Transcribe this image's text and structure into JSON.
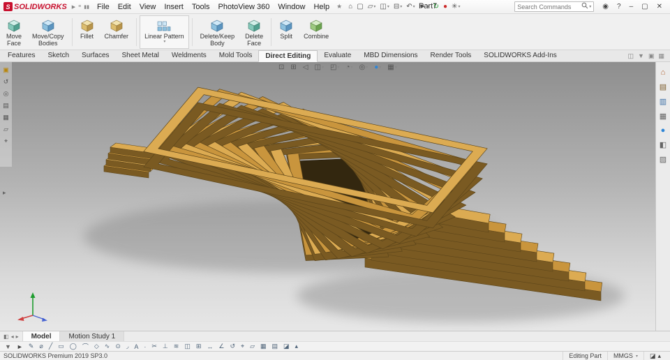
{
  "titlebar": {
    "brand": "SOLIDWORKS",
    "app_icon_letter": "S",
    "left_icons": [
      {
        "name": "play-icon",
        "glyph": "▶"
      },
      {
        "name": "list-icon",
        "glyph": "≡"
      },
      {
        "name": "pause-icon",
        "glyph": "▮▮"
      }
    ],
    "menus": [
      "File",
      "Edit",
      "View",
      "Insert",
      "Tools",
      "PhotoView 360",
      "Window",
      "Help"
    ],
    "pin_icon": "★",
    "quick_tools": [
      {
        "name": "home-icon",
        "glyph": "⌂"
      },
      {
        "name": "new-document-icon",
        "glyph": "▢"
      },
      {
        "name": "open-icon",
        "glyph": "▱",
        "dd": true
      },
      {
        "name": "save-icon",
        "glyph": "◫",
        "dd": true
      },
      {
        "name": "print-icon",
        "glyph": "⊟",
        "dd": true
      },
      {
        "name": "undo-icon",
        "glyph": "↶",
        "dd": true
      },
      {
        "name": "select-icon",
        "glyph": "►",
        "dd": true
      },
      {
        "name": "rebuild-icon",
        "glyph": "↻",
        "color": "#1f9d2f"
      },
      {
        "name": "stoplight-icon",
        "glyph": "●",
        "color": "#cc2a2a"
      },
      {
        "name": "options-icon",
        "glyph": "✳",
        "dd": true
      }
    ],
    "document_title": "Part7",
    "search": {
      "placeholder": "Search Commands",
      "dropdown_icon": "▾"
    },
    "window_controls": [
      {
        "name": "user-icon",
        "glyph": "◉"
      },
      {
        "name": "help-icon",
        "glyph": "?"
      },
      {
        "name": "minimize-icon",
        "glyph": "–"
      },
      {
        "name": "restore-icon",
        "glyph": "▢"
      },
      {
        "name": "close-icon",
        "glyph": "✕"
      }
    ]
  },
  "ribbon": {
    "buttons": [
      {
        "line1": "Move",
        "line2": "Face"
      },
      {
        "line1": "Move/Copy",
        "line2": "Bodies"
      },
      {
        "line1": "Fillet"
      },
      {
        "line1": "Chamfer"
      },
      {
        "line1": "Linear Pattern"
      },
      {
        "line1": "Delete/Keep",
        "line2": "Body"
      },
      {
        "line1": "Delete",
        "line2": "Face"
      },
      {
        "line1": "Split"
      },
      {
        "line1": "Combine"
      }
    ]
  },
  "tabs": {
    "items": [
      {
        "label": "Features"
      },
      {
        "label": "Sketch"
      },
      {
        "label": "Surfaces"
      },
      {
        "label": "Sheet Metal"
      },
      {
        "label": "Weldments"
      },
      {
        "label": "Mold Tools"
      },
      {
        "label": "Direct Editing",
        "active": true
      },
      {
        "label": "Evaluate"
      },
      {
        "label": "MBD Dimensions"
      },
      {
        "label": "Render Tools"
      },
      {
        "label": "SOLIDWORKS Add-Ins"
      }
    ],
    "right_icons": [
      {
        "name": "featuremanager-toggle-icon",
        "glyph": "◫"
      },
      {
        "name": "ribbon-pin-icon",
        "glyph": "▼"
      },
      {
        "name": "display-pane-icon",
        "glyph": "▣"
      },
      {
        "name": "ribbon-help-icon",
        "glyph": "▦"
      }
    ]
  },
  "viewport": {
    "hud_icons": [
      {
        "name": "zoom-fit-icon",
        "glyph": "⊡"
      },
      {
        "name": "zoom-area-icon",
        "glyph": "⊞"
      },
      {
        "name": "previous-view-icon",
        "glyph": "◁"
      },
      {
        "name": "section-view-icon",
        "glyph": "◫",
        "dd": true
      },
      {
        "name": "view-orientation-icon",
        "glyph": "◰",
        "dd": true
      },
      {
        "name": "display-style-icon",
        "glyph": "◔",
        "dd": true
      },
      {
        "name": "hide-show-items-icon",
        "glyph": "◎",
        "dd": true
      },
      {
        "name": "appearances-icon",
        "glyph": "●",
        "color": "#2f86d6",
        "dd": true
      },
      {
        "name": "scene-icon",
        "glyph": "▦",
        "dd": true
      }
    ],
    "left_tree_icons": [
      {
        "name": "part-icon",
        "glyph": "▣",
        "color": "#b8860b"
      },
      {
        "name": "history-icon",
        "glyph": "↺"
      },
      {
        "name": "sensors-icon",
        "glyph": "◎"
      },
      {
        "name": "annotations-icon",
        "glyph": "▤"
      },
      {
        "name": "material-icon",
        "glyph": "▦"
      },
      {
        "name": "plane-icon",
        "glyph": "▱"
      },
      {
        "name": "origin-icon",
        "glyph": "⌖"
      }
    ],
    "flyout_arrow_icon": "▸",
    "task_pane_icons": [
      {
        "name": "resources-home-icon",
        "glyph": "⌂",
        "color": "#b06030"
      },
      {
        "name": "design-library-icon",
        "glyph": "▤",
        "color": "#7a5a2a"
      },
      {
        "name": "file-explorer-icon",
        "glyph": "▥",
        "color": "#3a6ea5"
      },
      {
        "name": "view-palette-icon",
        "glyph": "▦",
        "color": "#666666"
      },
      {
        "name": "appearances-pane-icon",
        "glyph": "●",
        "color": "#2f86d6"
      },
      {
        "name": "scenes-icon",
        "glyph": "◧",
        "color": "#666666"
      },
      {
        "name": "custom-properties-icon",
        "glyph": "▨",
        "color": "#666666"
      }
    ],
    "bg_top": "#8e8e8e",
    "bg_bottom": "#e7e7e7",
    "wood": {
      "light": "#dcab52",
      "mid": "#c9953d",
      "dark": "#9a732c",
      "shadow_side": "#7a5a22",
      "edge": "#5c451a",
      "hole": "#33270f"
    },
    "shadow": "#5f5f5f",
    "triad": {
      "x": "#d04040",
      "y": "#1f9d2f",
      "z": "#3050d0"
    }
  },
  "model_tabs": {
    "nav_icons": [
      {
        "name": "splitter-icon",
        "glyph": "◧"
      },
      {
        "name": "tab-scroll-left-icon",
        "glyph": "◂"
      },
      {
        "name": "tab-scroll-right-icon",
        "glyph": "▸"
      }
    ],
    "items": [
      {
        "label": "Model",
        "active": true
      },
      {
        "label": "Motion Study 1"
      }
    ]
  },
  "sketch_toolbar": {
    "icons": [
      {
        "name": "selection-filter-icon",
        "glyph": "▼",
        "color": "#666666"
      },
      {
        "name": "select-arrow-icon",
        "glyph": "►",
        "color": "#444444"
      },
      {
        "name": "sketch-icon",
        "glyph": "✎"
      },
      {
        "name": "smart-dimension-icon",
        "glyph": "⌀"
      },
      {
        "name": "line-icon",
        "glyph": "╱"
      },
      {
        "name": "rectangle-icon",
        "glyph": "▭"
      },
      {
        "name": "circle-icon",
        "glyph": "◯"
      },
      {
        "name": "arc-icon",
        "glyph": "⌒"
      },
      {
        "name": "polygon-icon",
        "glyph": "◇"
      },
      {
        "name": "spline-icon",
        "glyph": "∿"
      },
      {
        "name": "ellipse-icon",
        "glyph": "⊙"
      },
      {
        "name": "sketch-fillet-icon",
        "glyph": "◞"
      },
      {
        "name": "text-icon",
        "glyph": "A"
      },
      {
        "name": "point-icon",
        "glyph": "·"
      },
      {
        "name": "trim-entities-icon",
        "glyph": "✂"
      },
      {
        "name": "convert-entities-icon",
        "glyph": "⊥"
      },
      {
        "name": "offset-entities-icon",
        "glyph": "≋"
      },
      {
        "name": "mirror-entities-icon",
        "glyph": "◫"
      },
      {
        "name": "linear-pattern-icon",
        "glyph": "⊞"
      },
      {
        "name": "move-entities-icon",
        "glyph": "↔"
      },
      {
        "name": "display-relations-icon",
        "glyph": "∠"
      },
      {
        "name": "repair-sketch-icon",
        "glyph": "↺"
      },
      {
        "name": "rapid-sketch-icon",
        "glyph": "⌖"
      },
      {
        "name": "plane-icon",
        "glyph": "▱"
      },
      {
        "name": "grid-icon",
        "glyph": "▦"
      },
      {
        "name": "instant2d-icon",
        "glyph": "▤"
      },
      {
        "name": "shaded-contours-icon",
        "glyph": "◪"
      },
      {
        "name": "units-icon",
        "glyph": "▴"
      }
    ]
  },
  "statusbar": {
    "left_text": "SOLIDWORKS Premium 2019 SP3.0",
    "editing_label": "Editing Part",
    "units_label": "MMGS",
    "units_dropdown_icon": "▾",
    "icons": [
      {
        "name": "status-tag-icon",
        "glyph": "◪"
      },
      {
        "name": "status-expand-icon",
        "glyph": "▴"
      }
    ]
  }
}
